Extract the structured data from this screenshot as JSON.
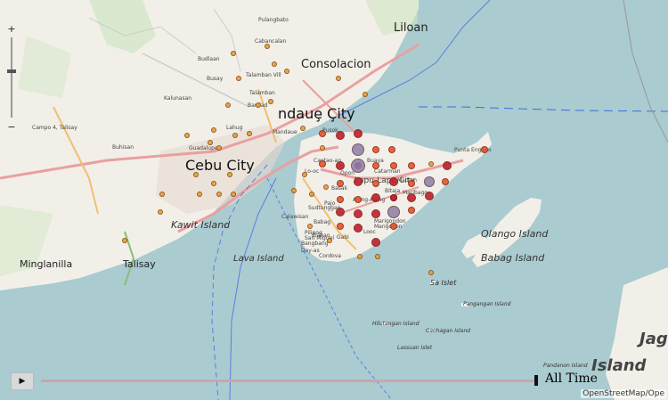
{
  "labels": {
    "cities": [
      {
        "text": "Cebu City",
        "cls": "big"
      },
      {
        "text": "ndauȩ Çity",
        "cls": "big"
      },
      {
        "text": "Lapu-Lapu City",
        "cls": "small"
      },
      {
        "text": "Consolacion",
        "cls": "med"
      },
      {
        "text": "Liloan",
        "cls": "med"
      },
      {
        "text": "Minglanilla",
        "cls": "med"
      },
      {
        "text": "Talisay",
        "cls": "med"
      }
    ],
    "islands": [
      "Kawit Island",
      "Lava Island",
      "Olango Island",
      "Babag Island"
    ],
    "islands_small": [
      "Sa Islet",
      "Pangangan Island",
      "Hilutangan Island",
      "Caohagan Island",
      "Lassuan Islet",
      "Pandanon Island"
    ],
    "island_big": [
      "Jag",
      "Island"
    ],
    "places": [
      "Budlaan",
      "Busay",
      "Talamban Vill",
      "Talamban",
      "Banilad",
      "Lahug",
      "Guadalupe",
      "Kalunasan",
      "Campo 4, Talisay",
      "Buhisan",
      "Punta Engaño",
      "Cantao-an",
      "Calawisan",
      "Pilipog",
      "San Miguel",
      "Bangbang",
      "Day-as",
      "Cordova",
      "Gabi",
      "Mangogon",
      "Bitaja",
      "Basak",
      "Mactan",
      "Marigondon",
      "Sudtunggan",
      "Babag",
      "Buaya",
      "Pusok",
      "Lo-oc",
      "Pulangbato",
      "Cabancalan",
      "Mandaue",
      "Maribago",
      "Opon",
      "Ibabao",
      "Catarman",
      "Alang-Alang",
      "Pajo",
      "Looc"
    ]
  },
  "controls": {
    "zoom_in": "+",
    "zoom_out": "−",
    "play": "▶",
    "time_label": "All Time",
    "attribution": "OpenStreetMap/Ope"
  },
  "colors": {
    "water": "#aacbd0",
    "land": "#f2efe9",
    "marker_red": "#c0202a",
    "marker_orange": "#e8532a",
    "marker_yellow": "#e8a030",
    "marker_purple": "#8c7ea8"
  }
}
